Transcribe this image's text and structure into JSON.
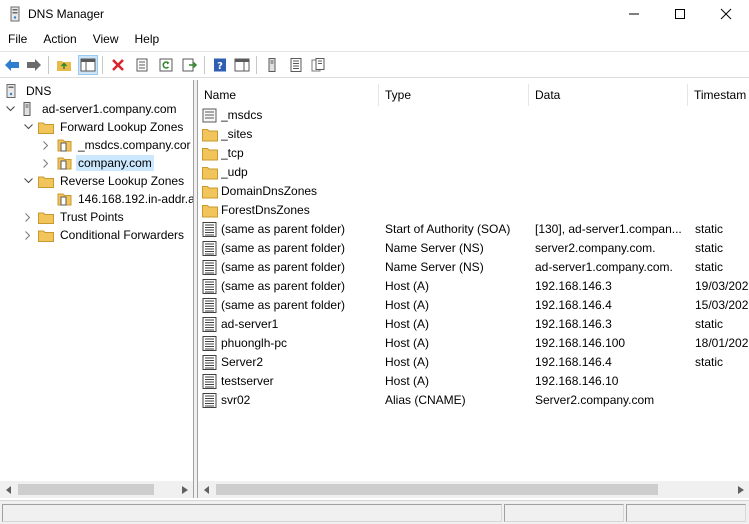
{
  "window": {
    "title": "DNS Manager"
  },
  "menu": [
    "File",
    "Action",
    "View",
    "Help"
  ],
  "tree": {
    "root": "DNS",
    "server": "ad-server1.company.com",
    "forward": "Forward Lookup Zones",
    "msdcs": "_msdcs.company.cor",
    "company": "company.com",
    "reverse": "Reverse Lookup Zones",
    "reverse_zone": "146.168.192.in-addr.a",
    "trust": "Trust Points",
    "conditional": "Conditional Forwarders"
  },
  "columns": {
    "name": "Name",
    "type": "Type",
    "data": "Data",
    "timestamp": "Timestam"
  },
  "records": [
    {
      "name": "_msdcs",
      "type": "",
      "data": "",
      "timestamp": "",
      "icon": "zone-icon"
    },
    {
      "name": "_sites",
      "type": "",
      "data": "",
      "timestamp": "",
      "icon": "folder-icon"
    },
    {
      "name": "_tcp",
      "type": "",
      "data": "",
      "timestamp": "",
      "icon": "folder-icon"
    },
    {
      "name": "_udp",
      "type": "",
      "data": "",
      "timestamp": "",
      "icon": "folder-icon"
    },
    {
      "name": "DomainDnsZones",
      "type": "",
      "data": "",
      "timestamp": "",
      "icon": "folder-icon"
    },
    {
      "name": "ForestDnsZones",
      "type": "",
      "data": "",
      "timestamp": "",
      "icon": "folder-icon"
    },
    {
      "name": "(same as parent folder)",
      "type": "Start of Authority (SOA)",
      "data": "[130], ad-server1.compan...",
      "timestamp": "static",
      "icon": "record-icon"
    },
    {
      "name": "(same as parent folder)",
      "type": "Name Server (NS)",
      "data": "server2.company.com.",
      "timestamp": "static",
      "icon": "record-icon"
    },
    {
      "name": "(same as parent folder)",
      "type": "Name Server (NS)",
      "data": "ad-server1.company.com.",
      "timestamp": "static",
      "icon": "record-icon"
    },
    {
      "name": "(same as parent folder)",
      "type": "Host (A)",
      "data": "192.168.146.3",
      "timestamp": "19/03/202",
      "icon": "record-icon"
    },
    {
      "name": "(same as parent folder)",
      "type": "Host (A)",
      "data": "192.168.146.4",
      "timestamp": "15/03/202",
      "icon": "record-icon"
    },
    {
      "name": "ad-server1",
      "type": "Host (A)",
      "data": "192.168.146.3",
      "timestamp": "static",
      "icon": "record-icon"
    },
    {
      "name": "phuonglh-pc",
      "type": "Host (A)",
      "data": "192.168.146.100",
      "timestamp": "18/01/202",
      "icon": "record-icon"
    },
    {
      "name": "Server2",
      "type": "Host (A)",
      "data": "192.168.146.4",
      "timestamp": "static",
      "icon": "record-icon"
    },
    {
      "name": "testserver",
      "type": "Host (A)",
      "data": "192.168.146.10",
      "timestamp": "",
      "icon": "record-icon"
    },
    {
      "name": "svr02",
      "type": "Alias (CNAME)",
      "data": "Server2.company.com",
      "timestamp": "",
      "icon": "record-icon"
    }
  ],
  "colors": {
    "selection": "#cce8ff",
    "folder": "#f2c55c",
    "red_delete": "#d9262e",
    "blue_help": "#2f5fb3"
  }
}
